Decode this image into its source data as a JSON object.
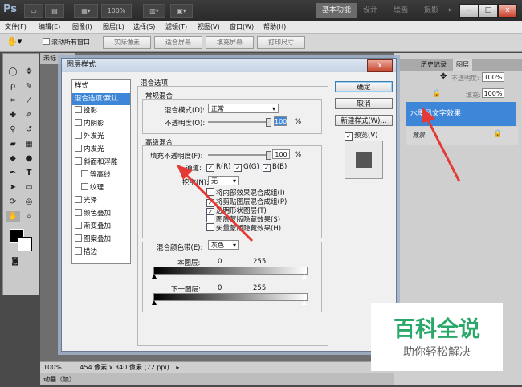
{
  "app": {
    "logo": "Ps",
    "zoom": "100%",
    "workspaces": [
      "基本功能",
      "设计",
      "绘画",
      "摄影"
    ]
  },
  "menu": [
    "文件(F)",
    "编辑(E)",
    "图像(I)",
    "图层(L)",
    "选择(S)",
    "滤镜(T)",
    "视图(V)",
    "窗口(W)",
    "帮助(H)"
  ],
  "options": {
    "scroll_all": "滚动所有窗口",
    "buttons": [
      "实际像素",
      "适合屏幕",
      "填充屏幕",
      "打印尺寸"
    ]
  },
  "doc": {
    "tab": "未标",
    "zoom": "100%",
    "status": "454 像素 x 340 像素 (72 ppi)",
    "anim_tab": "动画（帧）"
  },
  "right_panel": {
    "tabs": [
      "历史记录",
      "图层"
    ],
    "opacity_label": "不透明度:",
    "opacity": "100%",
    "fill_label": "填充:",
    "fill": "100%",
    "layers": [
      {
        "name": "水墨风文字效果"
      },
      {
        "name": "背景"
      }
    ]
  },
  "dialog": {
    "title": "图层样式",
    "close": "x",
    "styles_header": "样式",
    "styles": [
      "混合选项:默认",
      "投影",
      "内阴影",
      "外发光",
      "内发光",
      "斜面和浮雕",
      "等高线",
      "纹理",
      "光泽",
      "颜色叠加",
      "渐变叠加",
      "图案叠加",
      "描边"
    ],
    "blend_options_title": "混合选项",
    "general_title": "常规混合",
    "blend_mode_label": "混合模式(D):",
    "blend_mode": "正常",
    "opacity_label": "不透明度(O):",
    "opacity": "100",
    "pct": "%",
    "advanced_title": "高级混合",
    "fill_opacity_label": "填充不透明度(F):",
    "fill_opacity": "100",
    "channels_label": "通道:",
    "channels": [
      "R(R)",
      "G(G)",
      "B(B)"
    ],
    "knockout_label": "挖空(N):",
    "knockout": "无",
    "options": [
      "将内部效果混合成组(I)",
      "将剪贴图层混合成组(P)",
      "透明形状图层(T)",
      "图层蒙版隐藏效果(S)",
      "矢量蒙版隐藏效果(H)"
    ],
    "options_checked": [
      false,
      true,
      true,
      false,
      false
    ],
    "blend_if_label": "混合颜色带(E):",
    "blend_if": "灰色",
    "this_layer_label": "本图层:",
    "under_layer_label": "下一图层:",
    "range_low": "0",
    "range_high": "255",
    "buttons": {
      "ok": "确定",
      "cancel": "取消",
      "new_style": "新建样式(W)...",
      "preview": "预览(V)"
    }
  },
  "watermark": {
    "title": "百科全说",
    "subtitle": "助你轻松解决"
  },
  "colors": {
    "accent": "#3d86d8",
    "arrow": "#e53935",
    "watermark_green": "#2aa86a"
  }
}
